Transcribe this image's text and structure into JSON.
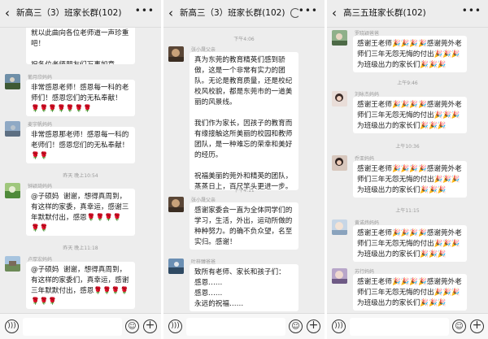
{
  "panels": [
    {
      "title": "新高三（3）班家长群(102)",
      "back_icon": "chevron-left-icon",
      "more_icon": "more-icon",
      "times": [
        "昨天 晚上10:54",
        "昨天 晚上11:18"
      ],
      "messages": [
        {
          "name": "",
          "text": "就以此曲向各位老师道一声珍重吧！\n\n祝各位老师朋友们万事如意。"
        },
        {
          "name": "葡月欣妈妈",
          "text": "非常感恩老师！感恩每一科的老师们！感恩您们的无私奉献！🌹🌹🌹🌹🌹🌹🌹"
        },
        {
          "name": "麦宇帆妈妈",
          "text": "非常感恩那老师！感恩每一科的老师们！感恩您们的无私奉献！🌹🌹"
        },
        {
          "name": "钟颖琦妈妈",
          "text": "@子硕妈  谢谢，想得真周到，有这样的家委，真幸运，感谢三年默默付出，感恩🌹🌹🌹🌹🌹🌹"
        },
        {
          "name": "卢厚宏妈妈",
          "text": "@子硕妈  谢谢，想得真周到，有这样的家委们，真幸运，感谢三年默默付出，感恩🌹🌹🌹🌹🌹🌹🌹"
        }
      ]
    },
    {
      "title": "新高三（3）班家长群(102)",
      "back_icon": "chevron-left-icon",
      "more_icon": "more-icon",
      "loading_icon": "loading-icon",
      "times": [
        "下午4:06",
        "下午4:11"
      ],
      "messages": [
        {
          "name": "张小晟父亲",
          "text": "真为东莞的教育精英们感到骄傲，这是一个非常有实力的团队。无论是教育质量，还是校纪校风校貌，都是东莞市的一道美丽的风景线。\n\n我们作为家长，因孩子的教育而有缘接触这所美丽的校园和教师团队，是一种难忘的荣幸和美好的经历。\n\n祝福美丽的莞外和精英的团队，蒸蒸日上，百尺竿头更进一步。"
        },
        {
          "name": "张小晟父亲",
          "text": "感谢家委会一直为全体同学们的学习，生活，外出，运动所做的种种努力。的确不负众望，名至实归。感谢！"
        },
        {
          "name": "叶梓臻爸爸",
          "text": "致所有老师、家长和孩子们：\n感恩……\n感恩……\n永远的祝福……"
        }
      ]
    },
    {
      "title": "高三五班家长群(102)",
      "back_icon": "chevron-left-icon",
      "more_icon": "more-icon",
      "times": [
        "上午9:46",
        "上午10:36",
        "上午11:15"
      ],
      "messages": [
        {
          "name": "罗晓颖爸爸",
          "text": "感谢王老师🎉🎉🎉🎉感谢莞外老师们三年无怨无悔的付出🎉🎉🎉为班级出力的家长们🎉🎉🎉"
        },
        {
          "name": "刘咏杰妈妈",
          "text": "感谢王老师🎉🎉🎉🎉感谢莞外老师们三年无怨无悔的付出🎉🎉🎉为班级出力的家长们🎉🎉🎉"
        },
        {
          "name": "乔亚妈妈",
          "text": "感谢王老师🎉🎉🎉🎉感谢莞外老师们三年无怨无悔的付出🎉🎉🎉为班级出力的家长们🎉🎉🎉"
        },
        {
          "name": "黄诺炜妈妈",
          "text": "感谢王老师🎉🎉🎉🎉感谢莞外老师们三年无怨无悔的付出🎉🎉🎉为班级出力的家长们🎉🎉🎉"
        },
        {
          "name": "苏行妈妈",
          "text": "感谢王老师🎉🎉🎉🎉感谢莞外老师们三年无怨无悔的付出🎉🎉🎉为班级出力的家长们🎉🎉🎉"
        }
      ]
    }
  ],
  "footer": {
    "voice_icon": "voice-icon",
    "emoji_icon": "emoji-icon",
    "plus_icon": "plus-icon"
  },
  "colors": {
    "background": "#ededed",
    "bubble": "#ffffff",
    "timestamp": "#9a9a9a"
  }
}
